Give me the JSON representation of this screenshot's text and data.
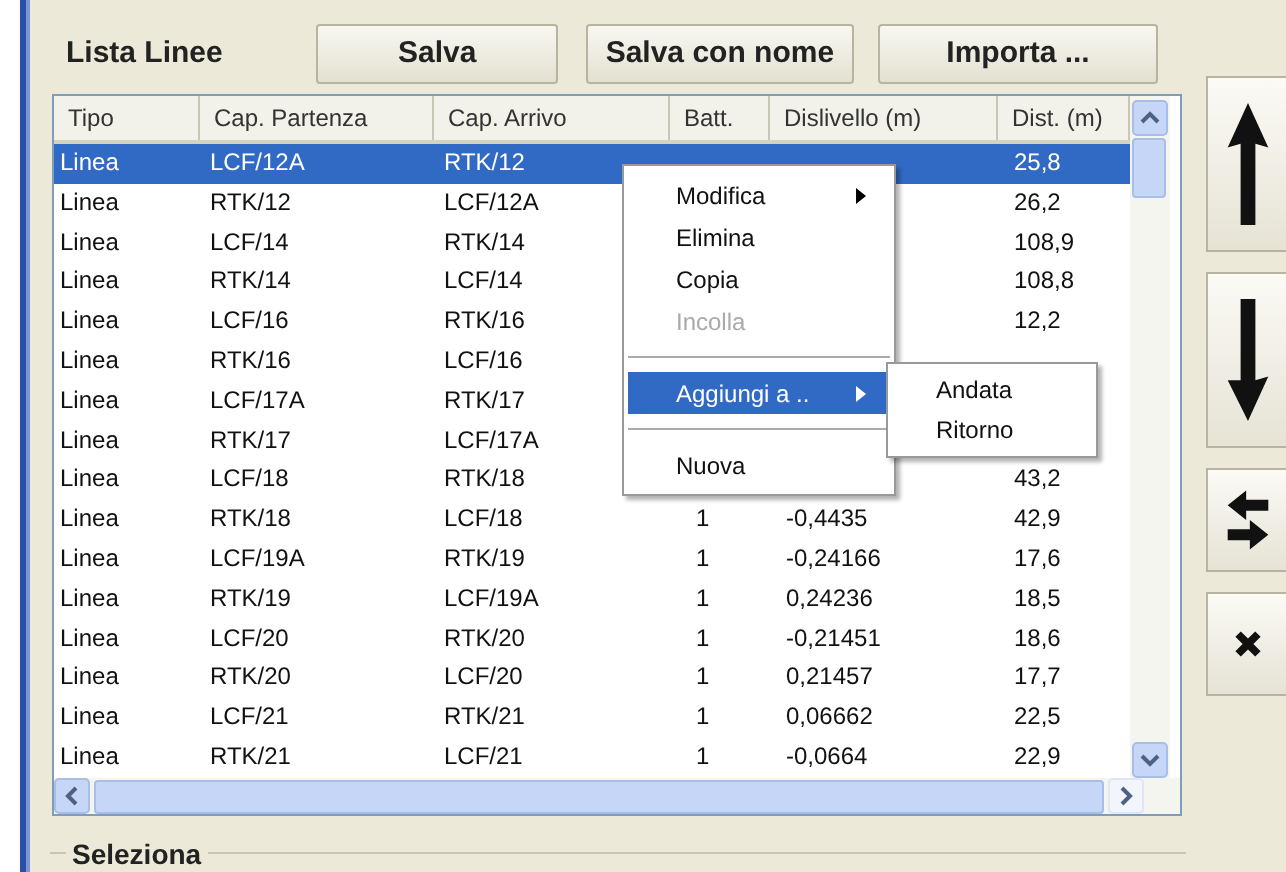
{
  "header": {
    "title": "Lista Linee",
    "buttons": [
      "Salva",
      "Salva con nome",
      "Importa ..."
    ]
  },
  "table": {
    "columns": [
      "Tipo",
      "Cap. Partenza",
      "Cap. Arrivo",
      "Batt.",
      "Dislivello (m)",
      "Dist. (m)"
    ],
    "rows": [
      {
        "tipo": "Linea",
        "partenza": "LCF/12A",
        "arrivo": "RTK/12",
        "dist": "25,8",
        "selected": true
      },
      {
        "tipo": "Linea",
        "partenza": "RTK/12",
        "arrivo": "LCF/12A",
        "dist": "26,2",
        "selected": false
      },
      {
        "tipo": "Linea",
        "partenza": "LCF/14",
        "arrivo": "RTK/14",
        "dist": "108,9",
        "selected": false
      },
      {
        "tipo": "Linea",
        "partenza": "RTK/14",
        "arrivo": "LCF/14",
        "dist": "108,8",
        "selected": false
      },
      {
        "tipo": "Linea",
        "partenza": "LCF/16",
        "arrivo": "RTK/16",
        "dist": "12,2",
        "selected": false
      },
      {
        "tipo": "Linea",
        "partenza": "RTK/16",
        "arrivo": "LCF/16",
        "selected": false
      },
      {
        "tipo": "Linea",
        "partenza": "LCF/17A",
        "arrivo": "RTK/17",
        "selected": false
      },
      {
        "tipo": "Linea",
        "partenza": "RTK/17",
        "arrivo": "LCF/17A",
        "selected": false
      },
      {
        "tipo": "Linea",
        "partenza": "LCF/18",
        "arrivo": "RTK/18",
        "dist": "43,2",
        "selected": false
      },
      {
        "tipo": "Linea",
        "partenza": "RTK/18",
        "arrivo": "LCF/18",
        "batt": "1",
        "dislivello": "-0,4435",
        "dist": "42,9",
        "selected": false
      },
      {
        "tipo": "Linea",
        "partenza": "LCF/19A",
        "arrivo": "RTK/19",
        "batt": "1",
        "dislivello": "-0,24166",
        "dist": "17,6",
        "selected": false
      },
      {
        "tipo": "Linea",
        "partenza": "RTK/19",
        "arrivo": "LCF/19A",
        "batt": "1",
        "dislivello": "0,24236",
        "dist": "18,5",
        "selected": false
      },
      {
        "tipo": "Linea",
        "partenza": "LCF/20",
        "arrivo": "RTK/20",
        "batt": "1",
        "dislivello": "-0,21451",
        "dist": "18,6",
        "selected": false
      },
      {
        "tipo": "Linea",
        "partenza": "RTK/20",
        "arrivo": "LCF/20",
        "batt": "1",
        "dislivello": "0,21457",
        "dist": "17,7",
        "selected": false
      },
      {
        "tipo": "Linea",
        "partenza": "LCF/21",
        "arrivo": "RTK/21",
        "batt": "1",
        "dislivello": "0,06662",
        "dist": "22,5",
        "selected": false
      },
      {
        "tipo": "Linea",
        "partenza": "RTK/21",
        "arrivo": "LCF/21",
        "batt": "1",
        "dislivello": "-0,0664",
        "dist": "22,9",
        "selected": false
      }
    ]
  },
  "context_menu": {
    "items": [
      {
        "kind": "item",
        "label": "Modifica",
        "submenu": true,
        "disabled": false,
        "selected": false
      },
      {
        "kind": "item",
        "label": "Elimina",
        "submenu": false,
        "disabled": false,
        "selected": false
      },
      {
        "kind": "item",
        "label": "Copia",
        "submenu": false,
        "disabled": false,
        "selected": false
      },
      {
        "kind": "item",
        "label": "Incolla",
        "submenu": false,
        "disabled": true,
        "selected": false
      },
      {
        "kind": "separator"
      },
      {
        "kind": "item",
        "label": "Aggiungi a ..",
        "submenu": true,
        "disabled": false,
        "selected": true
      },
      {
        "kind": "separator"
      },
      {
        "kind": "item",
        "label": "Nuova",
        "submenu": false,
        "disabled": false,
        "selected": false
      }
    ],
    "submenu": {
      "items": [
        "Andata",
        "Ritorno"
      ]
    }
  },
  "group": {
    "label": "Seleziona"
  }
}
